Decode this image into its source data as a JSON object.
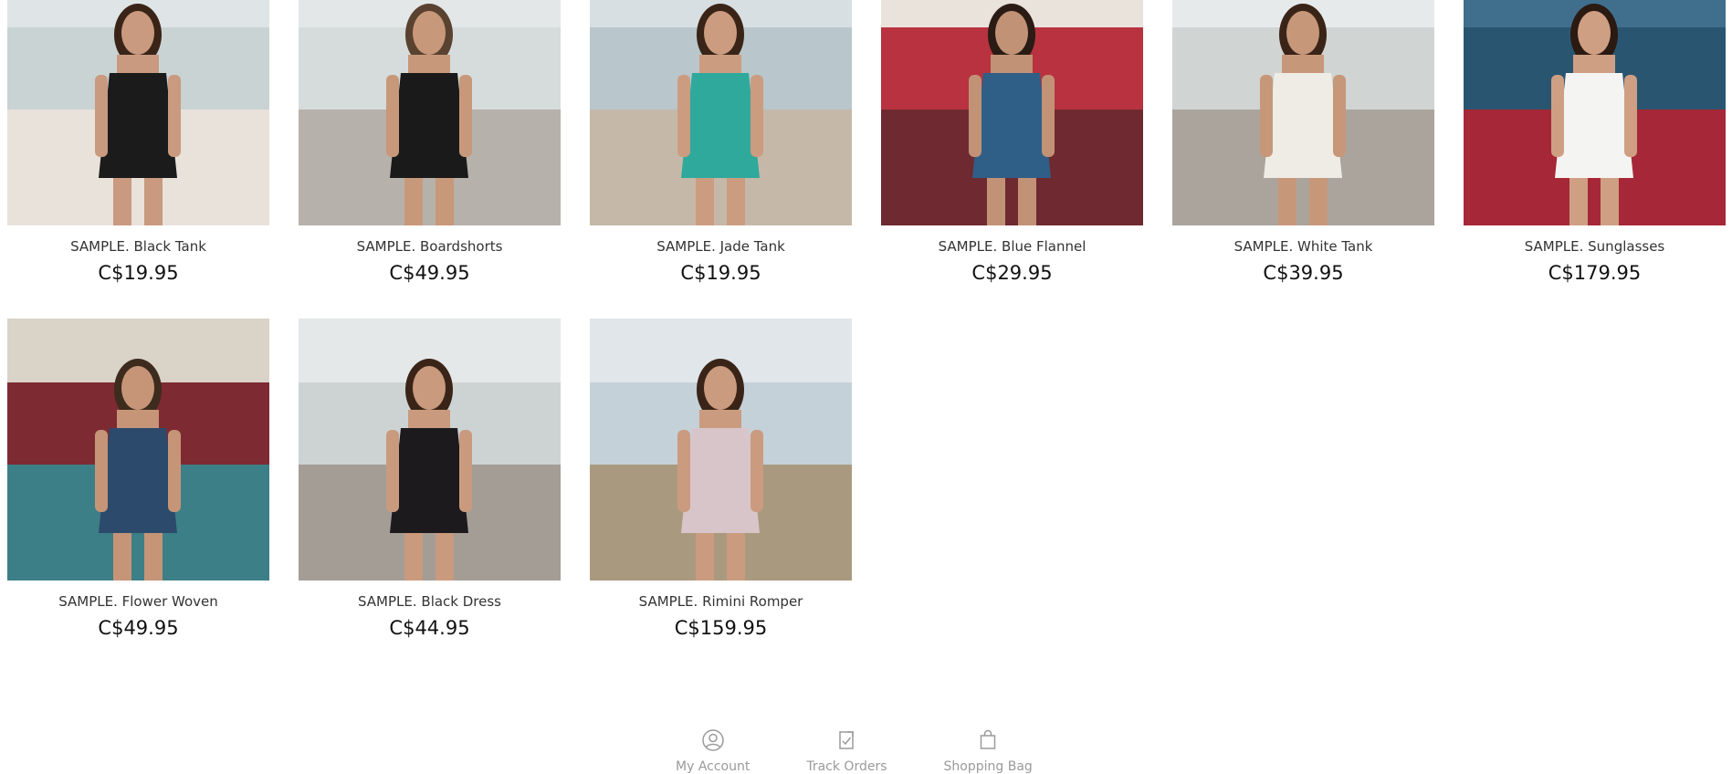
{
  "products": [
    {
      "name": "SAMPLE. Black Tank",
      "price": "C$19.95",
      "sky": "#dfe5e6",
      "sea": "#c9d3d4",
      "ground": "#e8e2da",
      "garment": "#1b1b1b",
      "skin": "#c99a7f",
      "hair": "#3a2418"
    },
    {
      "name": "SAMPLE. Boardshorts",
      "price": "C$49.95",
      "sky": "#e3e7e8",
      "sea": "#d6dcdc",
      "ground": "#b6b1aa",
      "garment": "#1a1a1a",
      "skin": "#c8987a",
      "hair": "#5a4230"
    },
    {
      "name": "SAMPLE. Jade Tank",
      "price": "C$19.95",
      "sky": "#d8dfe2",
      "sea": "#b9c6cb",
      "ground": "#c5b8a8",
      "garment": "#2fa99c",
      "skin": "#cc9c80",
      "hair": "#3a2418"
    },
    {
      "name": "SAMPLE. Blue Flannel",
      "price": "C$29.95",
      "sky": "#e9e3dc",
      "sea": "#b8333f",
      "ground": "#6e2a30",
      "garment": "#2f5f86",
      "skin": "#c29276",
      "hair": "#2a1c14"
    },
    {
      "name": "SAMPLE. White Tank",
      "price": "C$39.95",
      "sky": "#e7eaea",
      "sea": "#d0d4d3",
      "ground": "#aaa49d",
      "garment": "#efece6",
      "skin": "#c7977a",
      "hair": "#3a2418"
    },
    {
      "name": "SAMPLE. Sunglasses",
      "price": "C$179.95",
      "sky": "#3f6f8d",
      "sea": "#2a5570",
      "ground": "#a62737",
      "garment": "#f4f4f2",
      "skin": "#cf9f83",
      "hair": "#2a1a12"
    },
    {
      "name": "SAMPLE. Flower Woven",
      "price": "C$49.95",
      "sky": "#d9d3c8",
      "sea": "#7e2a32",
      "ground": "#3c7f86",
      "garment": "#2c4a6b",
      "skin": "#c69578",
      "hair": "#3d2b1e"
    },
    {
      "name": "SAMPLE. Black Dress",
      "price": "C$44.95",
      "sky": "#e5e8e8",
      "sea": "#cdd3d3",
      "ground": "#a39d96",
      "garment": "#1c1a1c",
      "skin": "#c99a7e",
      "hair": "#3a2418"
    },
    {
      "name": "SAMPLE. Rimini Romper",
      "price": "C$159.95",
      "sky": "#e1e6ea",
      "sea": "#c5d1d8",
      "ground": "#a99a7f",
      "garment": "#d8c5c9",
      "skin": "#cb9b7f",
      "hair": "#3a2418"
    }
  ],
  "footer": {
    "account_label": "My Account",
    "orders_label": "Track Orders",
    "bag_label": "Shopping Bag",
    "icon_color": "#9a9a9a"
  }
}
